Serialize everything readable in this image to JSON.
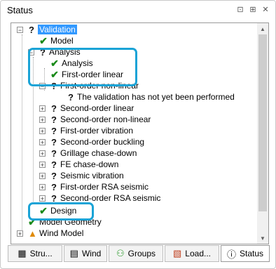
{
  "panel": {
    "title": "Status"
  },
  "titlebar_icons": [
    {
      "name": "pin-icon",
      "glyph": "⊡"
    },
    {
      "name": "pin-icon-2",
      "glyph": "⊞"
    },
    {
      "name": "close-icon",
      "glyph": "✕"
    }
  ],
  "tree": {
    "validation": "Validation",
    "model": "Model",
    "analysis_group": "Analysis",
    "analysis": "Analysis",
    "first_order_linear": "First-order linear",
    "first_order_non_linear": "First-order non-linear",
    "not_performed": "The validation has not yet been performed",
    "second_order_linear": "Second-order linear",
    "second_order_non_linear": "Second-order non-linear",
    "first_order_vibration": "First-order vibration",
    "second_order_buckling": "Second-order buckling",
    "grillage_chase_down": "Grillage chase-down",
    "fe_chase_down": "FE chase-down",
    "seismic_vibration": "Seismic vibration",
    "first_order_rsa_seismic": "First-order RSA seismic",
    "second_order_rsa_seismic": "Second-order RSA seismic",
    "design": "Design",
    "model_geometry": "Model Geometry",
    "wind_model": "Wind Model"
  },
  "tabs": [
    {
      "label": "Stru...",
      "icon": "structure-icon",
      "glyph": "▦"
    },
    {
      "label": "Wind",
      "icon": "wind-icon",
      "glyph": "▤"
    },
    {
      "label": "Groups",
      "icon": "groups-icon",
      "glyph": "⚇"
    },
    {
      "label": "Load...",
      "icon": "loading-icon",
      "glyph": "▧"
    },
    {
      "label": "Status",
      "icon": "status-icon",
      "glyph": "ⓘ"
    }
  ],
  "colors": {
    "highlight": "#1aa3d6",
    "selection": "#3399ff",
    "check": "#1a8a1a",
    "warning": "#e08a00"
  }
}
